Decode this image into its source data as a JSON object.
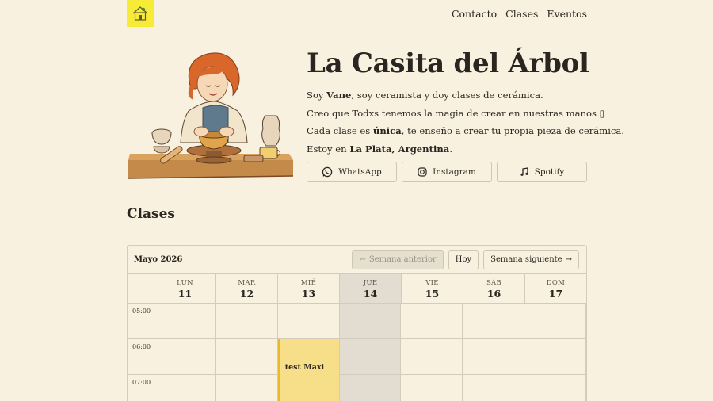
{
  "header": {
    "nav": [
      {
        "label": "Contacto"
      },
      {
        "label": "Clases"
      },
      {
        "label": "Eventos"
      }
    ],
    "logo_color": "#f6ec38"
  },
  "hero": {
    "title": "La Casita del Árbol",
    "bio": {
      "l1_pre": "Soy ",
      "l1_bold": "Vane",
      "l1_post": ", soy ceramista y doy clases de cerámica.",
      "l2": "Creo que Todxs tenemos la magia de crear en nuestras manos ▯",
      "l3_pre": "Cada clase es ",
      "l3_bold": "única",
      "l3_post": ", te enseño a crear tu propia pieza de cerámica.",
      "l4_pre": "Estoy en ",
      "l4_bold": "La Plata, Argentina",
      "l4_post": "."
    },
    "socials": [
      {
        "label": "WhatsApp",
        "icon": "whatsapp-icon"
      },
      {
        "label": "Instagram",
        "icon": "instagram-icon"
      },
      {
        "label": "Spotify",
        "icon": "music-note-icon"
      }
    ]
  },
  "classes": {
    "title": "Clases",
    "calendar": {
      "month": "Mayo 2026",
      "prev_label": "Semana anterior",
      "today_label": "Hoy",
      "next_label": "Semana siguiente",
      "days": [
        {
          "name": "LUN",
          "num": "11"
        },
        {
          "name": "MAR",
          "num": "12"
        },
        {
          "name": "MIÉ",
          "num": "13"
        },
        {
          "name": "JUE",
          "num": "14"
        },
        {
          "name": "VIE",
          "num": "15"
        },
        {
          "name": "SÁB",
          "num": "16"
        },
        {
          "name": "DOM",
          "num": "17"
        }
      ],
      "hours": [
        "05:00",
        "06:00",
        "07:00"
      ],
      "events": [
        {
          "title": "test Maxi",
          "day": "MIÉ",
          "start": "06:00"
        }
      ],
      "today_color": "#e2ddd0",
      "event_color": "#f7de89",
      "event_border": "#e8b92a"
    }
  }
}
